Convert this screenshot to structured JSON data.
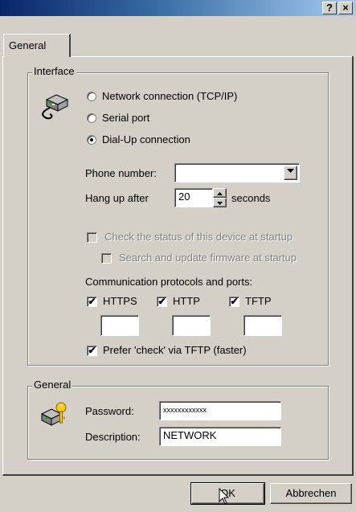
{
  "titlebar": {
    "help_label": "?",
    "close_label": "×"
  },
  "tabs": [
    {
      "label": "General"
    }
  ],
  "interface_group": {
    "title": "Interface",
    "radios": [
      {
        "label": "Network connection (TCP/IP)",
        "checked": false
      },
      {
        "label": "Serial port",
        "checked": false
      },
      {
        "label": "Dial-Up connection",
        "checked": true
      }
    ],
    "phone_label": "Phone number:",
    "phone_value": "",
    "hangup_label": "Hang up after",
    "hangup_value": "20",
    "hangup_unit": "seconds",
    "check_status_label": "Check the status of this device at startup",
    "search_firmware_label": "Search and update firmware at startup",
    "protocols_label": "Communication protocols and ports:",
    "protocols": [
      {
        "label": "HTTPS",
        "checked": true,
        "port": ""
      },
      {
        "label": "HTTP",
        "checked": true,
        "port": ""
      },
      {
        "label": "TFTP",
        "checked": true,
        "port": ""
      }
    ],
    "prefer_label": "Prefer 'check' via TFTP (faster)",
    "prefer_checked": true
  },
  "general_group": {
    "title": "General",
    "password_label": "Password:",
    "password_value": "xxxxxxxxxxxx",
    "description_label": "Description:",
    "description_value": "NETWORK"
  },
  "buttons": {
    "ok": "OK",
    "cancel": "Abbrechen"
  },
  "check_mark": "✔"
}
